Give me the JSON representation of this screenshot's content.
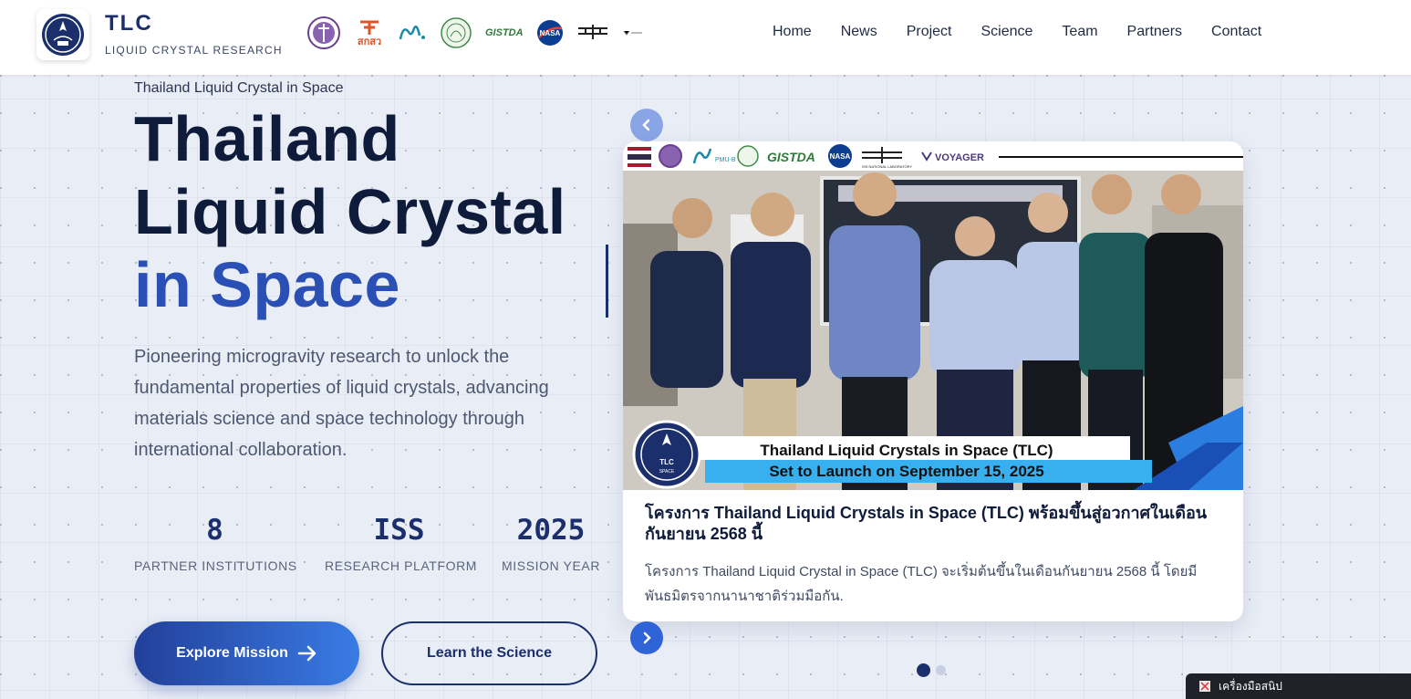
{
  "header": {
    "brand_title": "TLC",
    "brand_subtitle": "LIQUID CRYSTAL RESEARCH",
    "partner_logos": [
      "mhesi-seal-logo",
      "tsri-logo",
      "pmu-b-logo",
      "university-seal-logo",
      "gistda-logo",
      "nasa-logo",
      "iss-national-lab-logo",
      "voyager-logo"
    ],
    "partner_logo_texts": {
      "tsri": "สกสว",
      "gistda": "GISTDA",
      "nasa": "NASA"
    },
    "nav": [
      "Home",
      "News",
      "Project",
      "Science",
      "Team",
      "Partners",
      "Contact"
    ]
  },
  "hero": {
    "eyebrow": "Thailand Liquid Crystal in Space",
    "title_line1": "Thailand",
    "title_line2": "Liquid Crystal",
    "title_line3_a": "in ",
    "title_line3_b": "Space",
    "description": "Pioneering microgravity research to unlock the fundamental properties of liquid crystals, advancing materials science and space technology through international collaboration.",
    "stats": [
      {
        "value": "8",
        "label": "PARTNER INSTITUTIONS"
      },
      {
        "value": "ISS",
        "label": "RESEARCH PLATFORM"
      },
      {
        "value": "2025",
        "label": "MISSION YEAR"
      }
    ],
    "primary_button": "Explore Mission",
    "secondary_button": "Learn the Science"
  },
  "carousel": {
    "image_banner_logos": [
      "thai-flag",
      "mhesi-seal",
      "pmu-b",
      "university-seal",
      "gistda",
      "nasa",
      "iss-national-lab",
      "voyager"
    ],
    "image_logo_texts": {
      "pmu": "PMU-B",
      "gistda": "GISTDA",
      "nasa": "NASA",
      "iss": "ISS NATIONAL LABORATORY",
      "voyager": "VOYAGER"
    },
    "image_caption_line1": "Thailand Liquid Crystals in Space (TLC)",
    "image_caption_line2": "Set to Launch on September 15, 2025",
    "image_badge_text": "TLC",
    "image_badge_sub": "SPACE",
    "card_title": "โครงการ Thailand Liquid Crystals in Space (TLC) พร้อมขึ้นสู่อวกาศในเดือนกันยายน 2568 นี้",
    "card_description": "โครงการ Thailand Liquid Crystal in Space (TLC) จะเริ่มต้นขึ้นในเดือนกันยายน 2568 นี้ โดยมีพันธมิตรจากนานาชาติร่วมมือกัน.",
    "active_slide": 1,
    "slide_count": 2
  },
  "taskbar": {
    "label": "เครื่องมือสนิป"
  },
  "colors": {
    "navy": "#1a2f6b",
    "accent_blue": "#2a4fb5",
    "button_gradient_start": "#22409a",
    "button_gradient_end": "#3a7be5",
    "background": "#e9edf5"
  }
}
